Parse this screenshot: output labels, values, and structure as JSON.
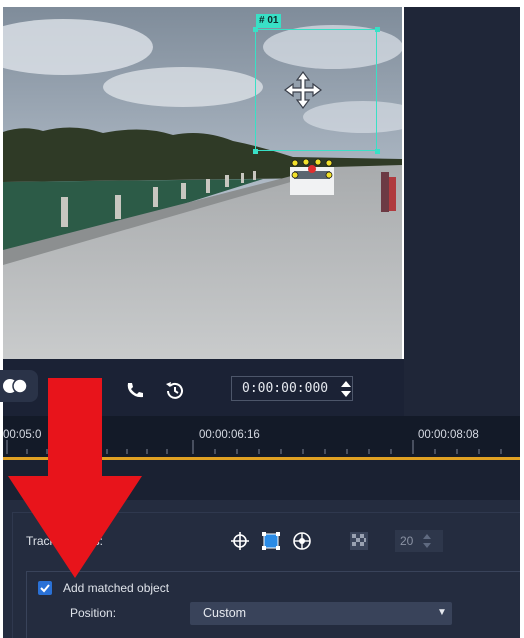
{
  "preview": {
    "tracking_label": "# 01"
  },
  "player": {
    "timecode": "0:00:00:000"
  },
  "ruler": {
    "ticks": [
      "00:05:0",
      "00:00:06:16",
      "00:00:08:08"
    ]
  },
  "tracking_panel": {
    "track_label": "Track",
    "track_label_suffix": "s:",
    "count_value": "20",
    "add_matched_object_label": "Add matched object",
    "add_matched_object_checked": true,
    "position_label": "Position:",
    "position_value": "Custom"
  },
  "colors": {
    "tracking_box": "#39e0c6",
    "accent_line": "#e0a123",
    "arrow": "#e8141b",
    "checkbox": "#2a71d6"
  }
}
